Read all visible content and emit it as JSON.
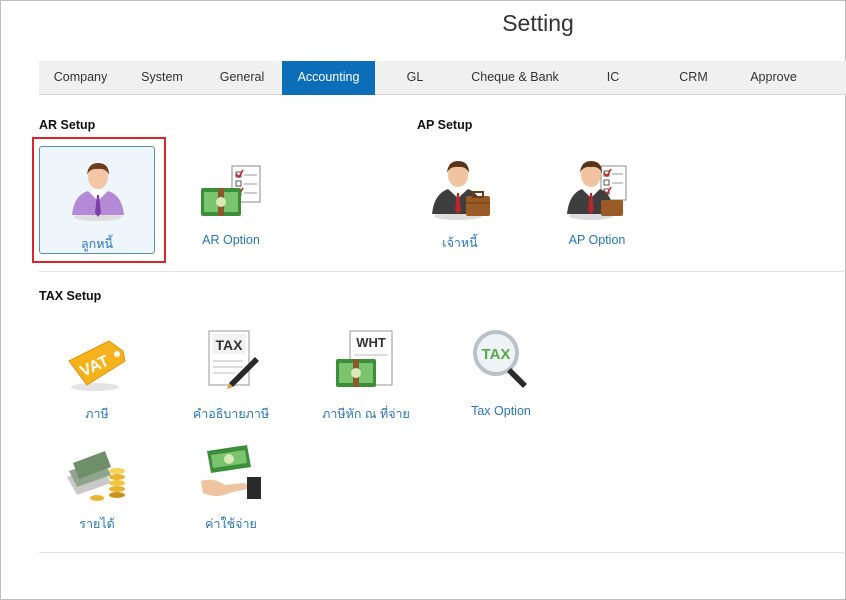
{
  "page": {
    "title": "Setting"
  },
  "tabs": [
    {
      "label": "Company"
    },
    {
      "label": "System"
    },
    {
      "label": "General"
    },
    {
      "label": "Accounting",
      "active": true
    },
    {
      "label": "GL"
    },
    {
      "label": "Cheque & Bank"
    },
    {
      "label": "IC"
    },
    {
      "label": "CRM"
    },
    {
      "label": "Approve"
    }
  ],
  "ar_setup": {
    "title": "AR Setup",
    "items": [
      {
        "label": "ลูกหนี้",
        "icon": "customer-person-icon",
        "selected": true
      },
      {
        "label": "AR Option",
        "icon": "money-checklist-icon"
      }
    ]
  },
  "ap_setup": {
    "title": "AP Setup",
    "items": [
      {
        "label": "เจ้าหนี้",
        "icon": "businessman-briefcase-icon"
      },
      {
        "label": "AP Option",
        "icon": "businessman-checklist-icon"
      }
    ]
  },
  "tax_setup": {
    "title": "TAX Setup",
    "items": [
      {
        "label": "ภาษี",
        "icon": "vat-tag-icon",
        "tag_text": "VAT"
      },
      {
        "label": "คำอธิบายภาษี",
        "icon": "tax-document-pen-icon",
        "doc_text": "TAX"
      },
      {
        "label": "ภาษีหัก ณ ที่จ่าย",
        "icon": "wht-money-icon",
        "doc_text": "WHT"
      },
      {
        "label": "Tax Option",
        "icon": "tax-magnifier-icon",
        "lens_text": "TAX"
      },
      {
        "label": "รายได้",
        "icon": "cash-coins-icon"
      },
      {
        "label": "ค่าใช้จ่าย",
        "icon": "hand-money-icon"
      }
    ]
  },
  "colors": {
    "accent": "#0c6db8",
    "link": "#2b74b8",
    "highlight": "#d9232d"
  }
}
